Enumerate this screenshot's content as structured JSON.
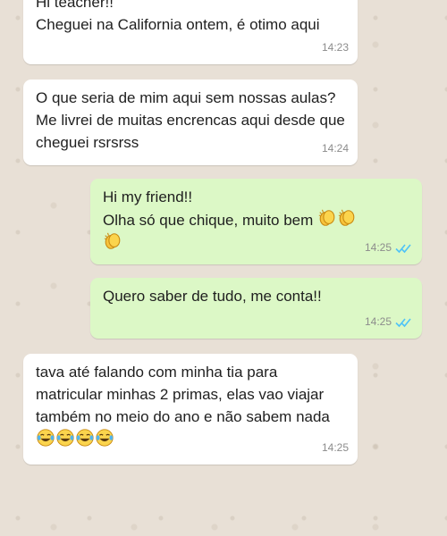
{
  "messages": [
    {
      "text": "Hi teacher!!\nCheguei na California ontem, é otimo aqui",
      "time": "14:23"
    },
    {
      "text": "O que seria de mim aqui sem nossas aulas? Me livrei de muitas encrencas aqui desde que cheguei rsrsrss",
      "time": "14:24"
    },
    {
      "text": "Hi my friend!!\nOlha só que chique, muito bem",
      "time": "14:25",
      "emojis": [
        "clapping-hands-icon",
        "clapping-hands-icon",
        "clapping-hands-icon"
      ]
    },
    {
      "text": "Quero saber de tudo, me conta!!",
      "time": "14:25"
    },
    {
      "text": "tava até falando com minha tia para matricular minhas 2 primas, elas vao viajar também no meio do ano e não sabem nada",
      "time": "14:25",
      "emojis": [
        "tears-of-joy-icon",
        "tears-of-joy-icon",
        "tears-of-joy-icon",
        "tears-of-joy-icon"
      ]
    }
  ],
  "colors": {
    "incoming_bubble": "#ffffff",
    "outgoing_bubble": "#dcf8c6",
    "read_ticks": "#4fc3f7",
    "timestamp": "#8c8c8c"
  }
}
